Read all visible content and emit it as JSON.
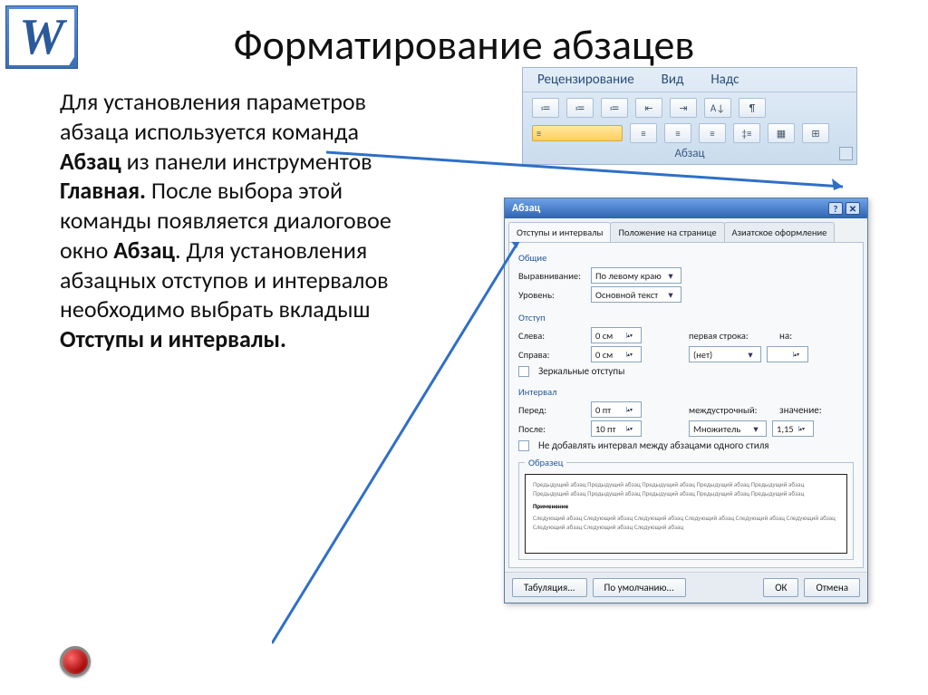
{
  "title": "Форматирование абзацев",
  "explain": {
    "p1": "Для установления параметров абзаца используется команда ",
    "b1": "Абзац",
    "p2": " из панели инструментов ",
    "b2": "Главная.",
    "p3": " После выбора этой команды появляется диалоговое окно ",
    "b3": "Абзац",
    "p4": ". Для установления абзацных отступов и интервалов необходимо выбрать вкладыш ",
    "b4": "Отступы и интервалы."
  },
  "ribbon": {
    "tabs": [
      "Рецензирование",
      "Вид",
      "Надс"
    ],
    "group_label": "Абзац"
  },
  "dialog": {
    "title": "Абзац",
    "tabs": [
      "Отступы и интервалы",
      "Положение на странице",
      "Азиатское оформление"
    ],
    "general_label": "Общие",
    "alignment_label": "Выравнивание:",
    "alignment_value": "По левому краю",
    "level_label": "Уровень:",
    "level_value": "Основной текст",
    "indent_label": "Отступ",
    "left_label": "Слева:",
    "left_value": "0 см",
    "right_label": "Справа:",
    "right_value": "0 см",
    "firstline_label": "первая строка:",
    "firstline_value": "(нет)",
    "by_label": "на:",
    "mirror_label": "Зеркальные отступы",
    "spacing_label": "Интервал",
    "before_label": "Перед:",
    "before_value": "0 пт",
    "after_label": "После:",
    "after_value": "10 пт",
    "linespacing_label": "междустрочный:",
    "linespacing_value": "Множитель",
    "at_label": "значение:",
    "at_value": "1,15",
    "noaddspace_label": "Не добавлять интервал между абзацами одного стиля",
    "sample_label": "Образец",
    "sample_text1": "Предыдущий абзац Предыдущий абзац Предыдущий абзац Предыдущий абзац Предыдущий абзац Предыдущий абзац Предыдущий абзац Предыдущий абзац Предыдущий абзац Предыдущий абзац",
    "sample_text2": "Применение",
    "sample_text3": "Следующий абзац Следующий абзац Следующий абзац Следующий абзац Следующий абзац Следующий абзац Следующий абзац Следующий абзац Следующий абзац",
    "btn_tabs": "Табуляция...",
    "btn_default": "По умолчанию...",
    "btn_ok": "ОК",
    "btn_cancel": "Отмена"
  }
}
